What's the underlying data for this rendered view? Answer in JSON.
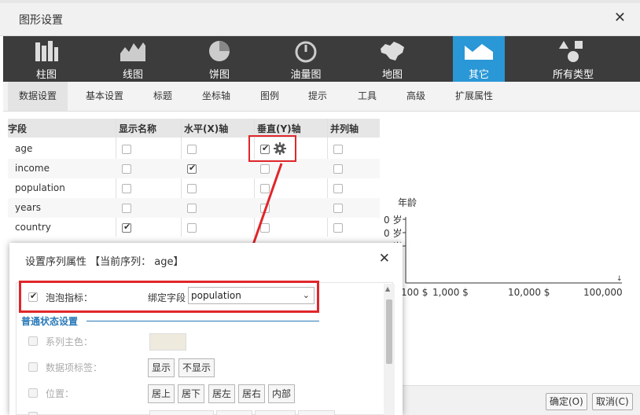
{
  "window": {
    "title": "图形设置",
    "close_glyph": "✕"
  },
  "chart_types": [
    {
      "label": "柱图",
      "icon": "bar-chart-icon",
      "active": false
    },
    {
      "label": "线图",
      "icon": "line-chart-icon",
      "active": false
    },
    {
      "label": "饼图",
      "icon": "pie-chart-icon",
      "active": false
    },
    {
      "label": "油量图",
      "icon": "gauge-icon",
      "active": false
    },
    {
      "label": "地图",
      "icon": "map-icon",
      "active": false
    },
    {
      "label": "其它",
      "icon": "area-chart-icon",
      "active": true
    },
    {
      "label": "所有类型",
      "icon": "all-types-icon",
      "active": false
    }
  ],
  "sub_tabs": [
    {
      "label": "数据设置",
      "active": true
    },
    {
      "label": "基本设置"
    },
    {
      "label": "标题"
    },
    {
      "label": "坐标轴"
    },
    {
      "label": "图例"
    },
    {
      "label": "提示"
    },
    {
      "label": "工具"
    },
    {
      "label": "高级"
    },
    {
      "label": "扩展属性"
    }
  ],
  "field_table": {
    "headers": [
      "字段",
      "显示名称",
      "水平(X)轴",
      "垂直(Y)轴",
      "并列轴"
    ],
    "rows": [
      {
        "name": "age",
        "show": false,
        "x": false,
        "y": true,
        "parallel": false
      },
      {
        "name": "income",
        "show": false,
        "x": true,
        "y": false,
        "parallel": false
      },
      {
        "name": "population",
        "show": false,
        "x": false,
        "y": false,
        "parallel": false
      },
      {
        "name": "years",
        "show": false,
        "x": false,
        "y": false,
        "parallel": false
      },
      {
        "name": "country",
        "show": true,
        "x": false,
        "y": false,
        "parallel": false
      }
    ]
  },
  "chart_preview": {
    "y_axis_name": "年龄",
    "y_ticks": [
      "0 岁",
      "0 岁",
      "0 岁"
    ],
    "x_ticks": [
      "100 $",
      "1,000 $",
      "10,000 $",
      "100,000"
    ],
    "x_axis_end_mark": "↓"
  },
  "footer": {
    "ok_label": "确定(O)",
    "cancel_label": "取消(C)"
  },
  "series_dialog": {
    "title": "设置序列属性 【当前序列： age】",
    "close_glyph": "✕",
    "bubble_checkbox_checked": true,
    "bubble_label": "泡泡指标：",
    "bind_field_label": "绑定字段",
    "bind_field_value": "population",
    "section_title": "普通状态设置",
    "series_color_label": "系列主色：",
    "series_color_value": "#eeeadd",
    "data_label_label": "数据项标签：",
    "data_label_options": [
      "显示",
      "不显示"
    ],
    "position_label": "位置：",
    "position_options": [
      "居上",
      "居下",
      "居左",
      "居右",
      "内部"
    ]
  }
}
